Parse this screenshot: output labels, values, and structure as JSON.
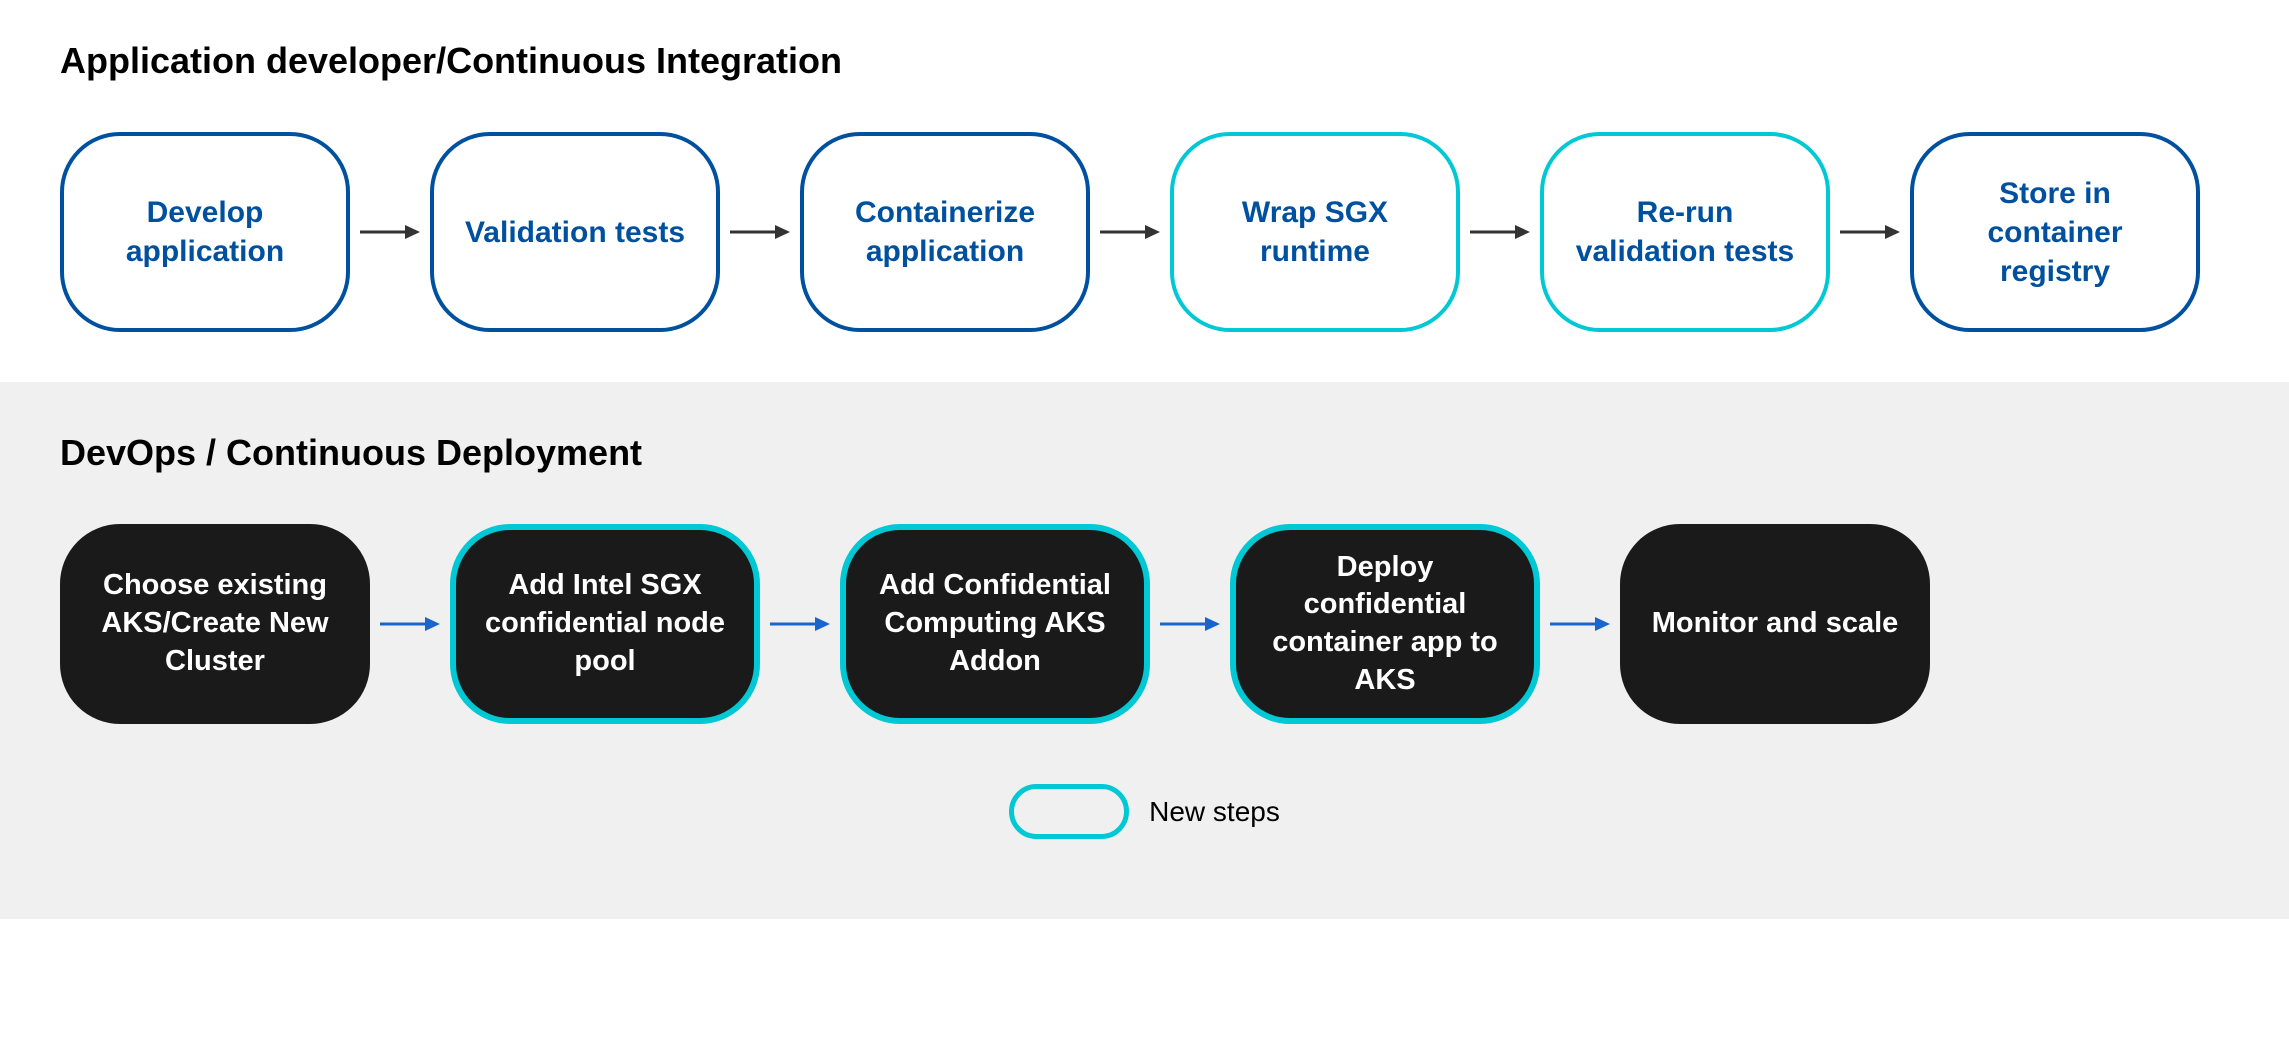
{
  "top_section": {
    "title": "Application developer/Continuous Integration",
    "nodes": [
      {
        "id": "develop",
        "label": "Develop application",
        "type": "normal"
      },
      {
        "id": "validation",
        "label": "Validation tests",
        "type": "normal"
      },
      {
        "id": "containerize",
        "label": "Containerize application",
        "type": "normal"
      },
      {
        "id": "wrap-sgx",
        "label": "Wrap SGX runtime",
        "type": "cyan"
      },
      {
        "id": "rerun",
        "label": "Re-run validation tests",
        "type": "cyan"
      },
      {
        "id": "store",
        "label": "Store in container registry",
        "type": "normal"
      }
    ]
  },
  "bottom_section": {
    "title": "DevOps / Continuous Deployment",
    "nodes": [
      {
        "id": "choose",
        "label": "Choose existing AKS/Create New Cluster",
        "type": "normal"
      },
      {
        "id": "add-sgx",
        "label": "Add Intel SGX confidential node pool",
        "type": "cyan"
      },
      {
        "id": "add-cc",
        "label": "Add Confidential Computing AKS Addon",
        "type": "cyan"
      },
      {
        "id": "deploy",
        "label": "Deploy confidential container app to AKS",
        "type": "cyan"
      },
      {
        "id": "monitor",
        "label": "Monitor and scale",
        "type": "normal"
      }
    ]
  },
  "legend": {
    "label": "New steps"
  }
}
